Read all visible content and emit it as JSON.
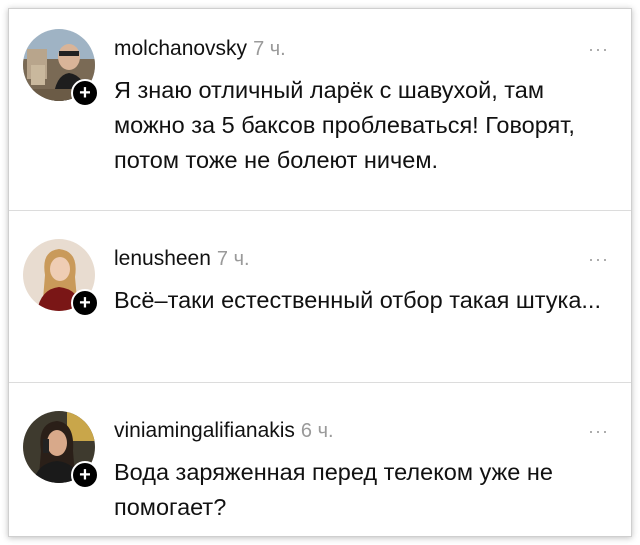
{
  "comments": [
    {
      "username": "molchanovsky",
      "time": "7 ч.",
      "text": "Я знаю отличный ларёк с шавухой, там можно за 5 баксов проблеваться! Говорят, потом тоже не болеют ничем.",
      "more_icon": "···",
      "follow_icon": "+"
    },
    {
      "username": "lenusheen",
      "time": "7 ч.",
      "text": "Всё–таки естественный отбор такая штука...",
      "more_icon": "···",
      "follow_icon": "+"
    },
    {
      "username": "viniamingalifianakis",
      "time": "6 ч.",
      "text": "Вода заряженная перед телеком уже не помогает?",
      "more_icon": "···",
      "follow_icon": "+"
    }
  ]
}
